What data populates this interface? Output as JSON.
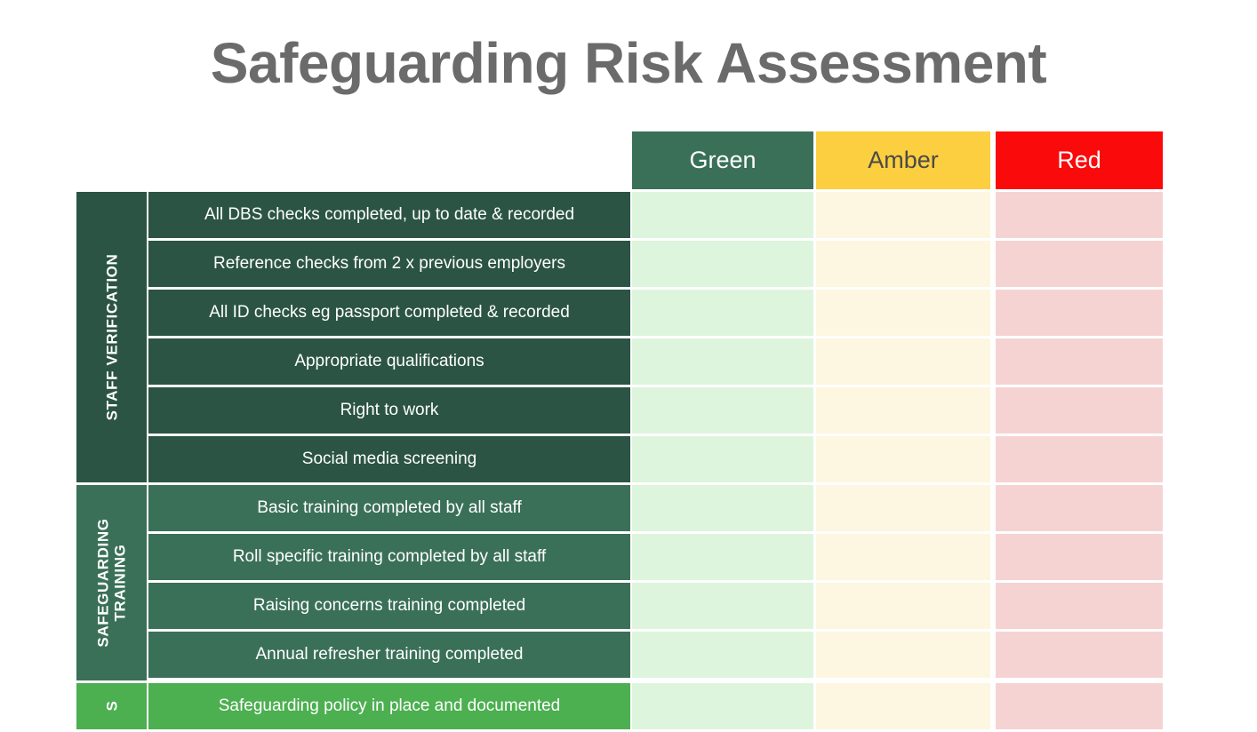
{
  "page": {
    "title": "Safeguarding Risk Assessment",
    "background": "#ffffff",
    "title_color": "#6b6b6b"
  },
  "matrix": {
    "columns": [
      {
        "key": "green",
        "label": "Green",
        "header_bg": "#3a7058",
        "header_text": "#ffffff",
        "cell_bg": "#ddf5dd"
      },
      {
        "key": "amber",
        "label": "Amber",
        "header_bg": "#fbcf3f",
        "header_text": "#4a4a4a",
        "cell_bg": "#fdf6e0"
      },
      {
        "key": "red",
        "label": "Red",
        "header_bg": "#fa0a0a",
        "header_text": "#ffffff",
        "cell_bg": "#f6d3d3"
      }
    ],
    "sections": [
      {
        "id": "staff-verification",
        "category": "STAFF VERIFICATION",
        "category_lines": [
          "STAFF VERIFICATION"
        ],
        "color": "#2b5444",
        "rows": [
          "All DBS checks completed, up to date & recorded",
          "Reference checks from 2 x previous employers",
          "All ID checks eg passport completed & recorded",
          "Appropriate qualifications",
          "Right to work",
          "Social media screening"
        ]
      },
      {
        "id": "safeguarding-training",
        "category": "SAFEGUARDING TRAINING",
        "category_lines": [
          "SAFEGUARDING",
          "TRAINING"
        ],
        "color": "#3a7058",
        "rows": [
          "Basic training completed by all staff",
          "Roll specific training completed by all staff",
          "Raising concerns training completed",
          "Annual refresher training completed"
        ]
      },
      {
        "id": "policies",
        "category": "S",
        "category_lines": [
          "S"
        ],
        "color": "#4caf50",
        "rows": [
          "Safeguarding policy in place and documented"
        ]
      }
    ]
  }
}
